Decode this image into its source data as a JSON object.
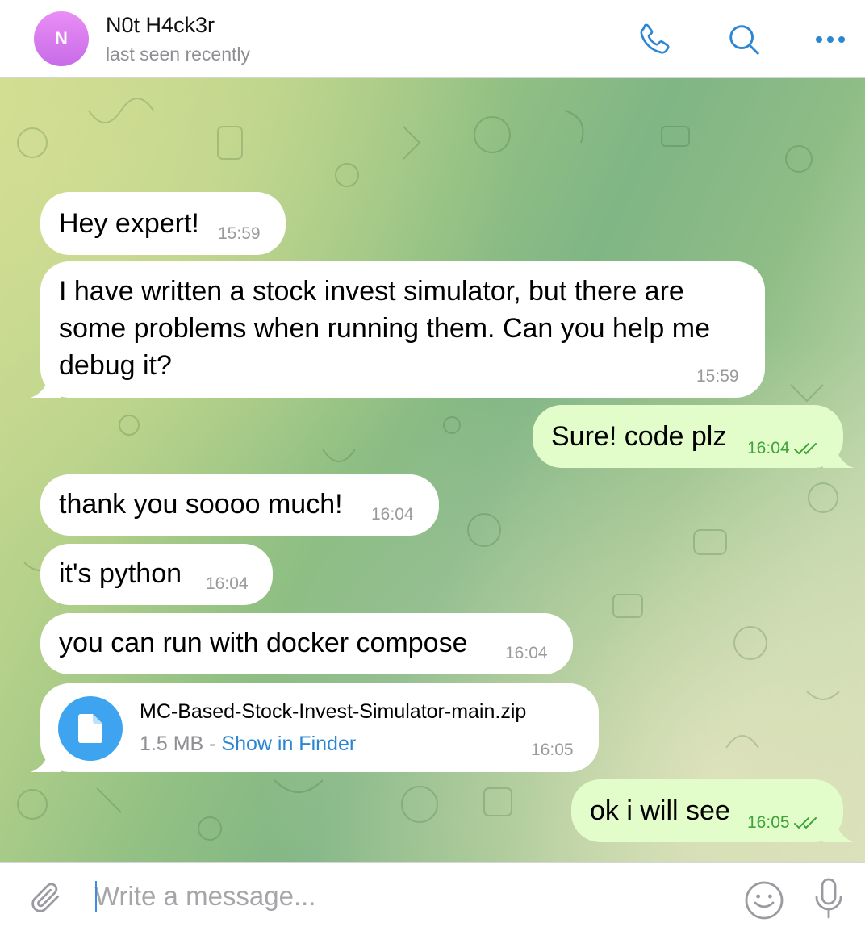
{
  "header": {
    "avatar_letter": "N",
    "contact_name": "N0t H4ck3r",
    "status": "last seen recently",
    "icons": [
      "phone-icon",
      "search-icon",
      "more-icon"
    ]
  },
  "messages": [
    {
      "direction": "in",
      "text": "Hey expert!",
      "time": "15:59"
    },
    {
      "direction": "in",
      "text": "I have written a stock invest simulator, but there are\nsome problems when running them. Can you help me\ndebug it?",
      "time": "15:59"
    },
    {
      "direction": "out",
      "text": "Sure! code plz",
      "time": "16:04",
      "read": true
    },
    {
      "direction": "in",
      "text": "thank you soooo much!",
      "time": "16:04"
    },
    {
      "direction": "in",
      "text": "it's python",
      "time": "16:04"
    },
    {
      "direction": "in",
      "text": "you can run with docker compose",
      "time": "16:04"
    },
    {
      "direction": "in",
      "type": "file",
      "file_name": "MC-Based-Stock-Invest-Simulator-main.zip",
      "file_size": "1.5 MB",
      "separator": " - ",
      "action": "Show in Finder",
      "time": "16:05"
    },
    {
      "direction": "out",
      "text": "ok i will see",
      "time": "16:05",
      "read": true
    }
  ],
  "composer": {
    "placeholder": "Write a message...",
    "value": ""
  },
  "colors": {
    "accent": "#2b86d3",
    "outgoing_bubble": "#e2fdc9",
    "outgoing_time": "#3fa33c",
    "file_icon": "#3ea4f0",
    "avatar": "#d97cf0"
  }
}
